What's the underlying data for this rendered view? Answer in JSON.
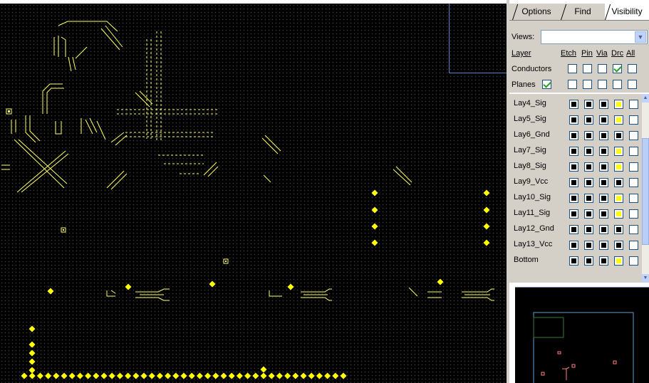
{
  "tabs": [
    {
      "label": "Options",
      "active": false
    },
    {
      "label": "Find",
      "active": false
    },
    {
      "label": "Visibility",
      "active": true
    }
  ],
  "visibility": {
    "views_label": "Views:",
    "views_value": "",
    "columns": {
      "layer": "Layer",
      "etch": "Etch",
      "pin": "Pin",
      "via": "Via",
      "drc": "Drc",
      "all": "All"
    },
    "groups": [
      {
        "label": "Conductors",
        "main": null,
        "etch": false,
        "pin": false,
        "via": false,
        "drc": true,
        "all": false
      },
      {
        "label": "Planes",
        "main": true,
        "etch": false,
        "pin": false,
        "via": false,
        "drc": false,
        "all": false
      }
    ]
  },
  "layers": [
    {
      "name": "Lay4_Sig",
      "etch": "black",
      "pin": "black",
      "via": "black",
      "drc": "yellow",
      "all": "empty"
    },
    {
      "name": "Lay5_Sig",
      "etch": "black",
      "pin": "black",
      "via": "black",
      "drc": "yellow",
      "all": "empty"
    },
    {
      "name": "Lay6_Gnd",
      "etch": "black",
      "pin": "black",
      "via": "black",
      "drc": "black",
      "all": "empty"
    },
    {
      "name": "Lay7_Sig",
      "etch": "black",
      "pin": "black",
      "via": "black",
      "drc": "yellow",
      "all": "empty"
    },
    {
      "name": "Lay8_Sig",
      "etch": "black",
      "pin": "black",
      "via": "black",
      "drc": "yellow",
      "all": "empty"
    },
    {
      "name": "Lay9_Vcc",
      "etch": "black",
      "pin": "black",
      "via": "black",
      "drc": "black",
      "all": "empty"
    },
    {
      "name": "Lay10_Sig",
      "etch": "black",
      "pin": "black",
      "via": "black",
      "drc": "yellow",
      "all": "empty"
    },
    {
      "name": "Lay11_Sig",
      "etch": "black",
      "pin": "black",
      "via": "black",
      "drc": "yellow",
      "all": "empty"
    },
    {
      "name": "Lay12_Gnd",
      "etch": "black",
      "pin": "black",
      "via": "black",
      "drc": "black",
      "all": "empty"
    },
    {
      "name": "Lay13_Vcc",
      "etch": "black",
      "pin": "black",
      "via": "black",
      "drc": "black",
      "all": "empty"
    },
    {
      "name": "Bottom",
      "etch": "black",
      "pin": "black",
      "via": "black",
      "drc": "yellow",
      "all": "empty"
    }
  ],
  "colors": {
    "trace": "#ffff66",
    "pad": "#ffff00",
    "window_frame": "#5a7ec8",
    "minimap_outline": "#5ba0d0",
    "minimap_component": "#ff8080",
    "minimap_region": "#3a7a3a"
  },
  "icons": {
    "dropdown": "chevron-down-icon",
    "scroll_up": "scroll-up-icon",
    "scroll_down": "scroll-down-icon"
  }
}
